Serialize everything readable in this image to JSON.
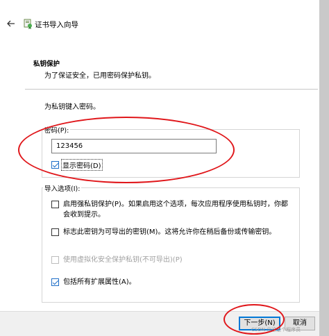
{
  "window": {
    "title": "证书导入向导"
  },
  "header": {
    "title": "私钥保护",
    "description": "为了保证安全，已用密码保护私钥。"
  },
  "prompt": "为私钥键入密码。",
  "password": {
    "group_label": "密码(P):",
    "value": "123456",
    "show_label": "显示密码(D)",
    "show_checked": true
  },
  "import_options": {
    "group_label": "导入选项(I):",
    "options": [
      {
        "label": "启用强私钥保护(P)。如果启用这个选项，每次应用程序使用私钥时，你都会收到提示。",
        "checked": false,
        "enabled": true
      },
      {
        "label": "标志此密钥为可导出的密钥(M)。这将允许你在稍后备份或传输密钥。",
        "checked": false,
        "enabled": true
      },
      {
        "label": "使用虚拟化安全保护私钥(不可导出)(P)",
        "checked": false,
        "enabled": false
      },
      {
        "label": "包括所有扩展属性(A)。",
        "checked": true,
        "enabled": true
      }
    ]
  },
  "footer": {
    "next_label": "下一步(N)",
    "cancel_label": "取消",
    "watermark": "CSDN @这是个程序员"
  },
  "colors": {
    "annotation": "#e0161a",
    "accent": "#0078d7"
  },
  "icons": {
    "back": "arrow-left-icon",
    "wizard": "certificate-wizard-icon"
  }
}
